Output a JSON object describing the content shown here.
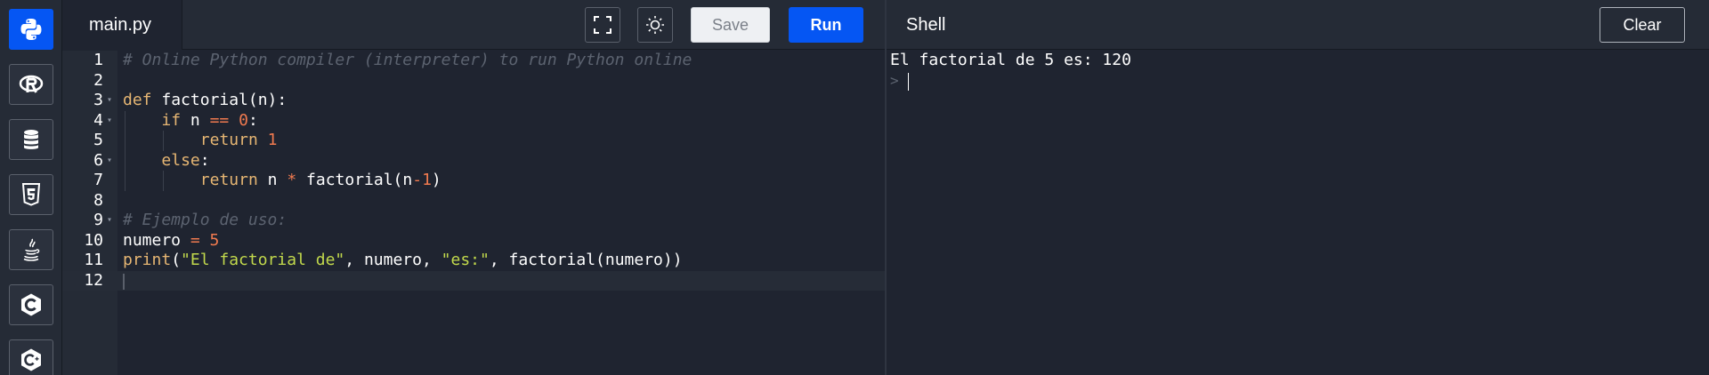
{
  "sidebar": {
    "languages": [
      {
        "name": "Python",
        "icon": "python-icon",
        "active": true
      },
      {
        "name": "R",
        "icon": "r-language-icon",
        "active": false
      },
      {
        "name": "SQL",
        "icon": "database-icon",
        "active": false
      },
      {
        "name": "HTML",
        "icon": "html5-icon",
        "active": false
      },
      {
        "name": "Java",
        "icon": "java-icon",
        "active": false
      },
      {
        "name": "C",
        "icon": "c-language-icon",
        "active": false
      },
      {
        "name": "C++",
        "icon": "cpp-language-icon",
        "active": false
      }
    ]
  },
  "editor": {
    "file_name": "main.py",
    "save_label": "Save",
    "run_label": "Run",
    "fullscreen_icon": "fullscreen-icon",
    "theme_icon": "sun-icon",
    "lines": [
      {
        "number": "1",
        "fold": false,
        "indent": 0,
        "tokens": [
          {
            "t": "# Online Python compiler (interpreter) to run Python online",
            "c": "comment"
          }
        ]
      },
      {
        "number": "2",
        "fold": false,
        "indent": 0,
        "tokens": []
      },
      {
        "number": "3",
        "fold": true,
        "indent": 0,
        "tokens": [
          {
            "t": "def",
            "c": "kw"
          },
          {
            "t": " factorial(n):",
            "c": "id"
          }
        ]
      },
      {
        "number": "4",
        "fold": true,
        "indent": 1,
        "tokens": [
          {
            "t": "if",
            "c": "kw"
          },
          {
            "t": " n ",
            "c": "id"
          },
          {
            "t": "==",
            "c": "op"
          },
          {
            "t": " ",
            "c": "id"
          },
          {
            "t": "0",
            "c": "num"
          },
          {
            "t": ":",
            "c": "id"
          }
        ]
      },
      {
        "number": "5",
        "fold": false,
        "indent": 2,
        "tokens": [
          {
            "t": "return",
            "c": "kw"
          },
          {
            "t": " ",
            "c": "id"
          },
          {
            "t": "1",
            "c": "num"
          }
        ]
      },
      {
        "number": "6",
        "fold": true,
        "indent": 1,
        "tokens": [
          {
            "t": "else",
            "c": "kw"
          },
          {
            "t": ":",
            "c": "id"
          }
        ]
      },
      {
        "number": "7",
        "fold": false,
        "indent": 2,
        "tokens": [
          {
            "t": "return",
            "c": "kw"
          },
          {
            "t": " n ",
            "c": "id"
          },
          {
            "t": "*",
            "c": "op"
          },
          {
            "t": " factorial(n",
            "c": "id"
          },
          {
            "t": "-",
            "c": "op"
          },
          {
            "t": "1",
            "c": "num"
          },
          {
            "t": ")",
            "c": "id"
          }
        ]
      },
      {
        "number": "8",
        "fold": false,
        "indent": 0,
        "tokens": []
      },
      {
        "number": "9",
        "fold": true,
        "indent": 0,
        "tokens": [
          {
            "t": "# Ejemplo de uso:",
            "c": "comment"
          }
        ]
      },
      {
        "number": "10",
        "fold": false,
        "indent": 0,
        "tokens": [
          {
            "t": "numero ",
            "c": "id"
          },
          {
            "t": "=",
            "c": "op"
          },
          {
            "t": " ",
            "c": "id"
          },
          {
            "t": "5",
            "c": "num"
          }
        ]
      },
      {
        "number": "11",
        "fold": false,
        "indent": 0,
        "tokens": [
          {
            "t": "print",
            "c": "kw"
          },
          {
            "t": "(",
            "c": "id"
          },
          {
            "t": "\"El factorial de\"",
            "c": "str"
          },
          {
            "t": ", numero, ",
            "c": "id"
          },
          {
            "t": "\"es:\"",
            "c": "str"
          },
          {
            "t": ", factorial(numero))",
            "c": "id"
          }
        ]
      },
      {
        "number": "12",
        "fold": false,
        "indent": 0,
        "tokens": [],
        "active": true
      }
    ]
  },
  "shell": {
    "title": "Shell",
    "clear_label": "Clear",
    "output": [
      "El factorial de 5 es: 120"
    ],
    "prompt": ">"
  },
  "colors": {
    "accent": "#0556f3",
    "background": "#1f2430",
    "keyword": "#e6b673",
    "number": "#f07a4f",
    "string": "#c2d94c",
    "comment": "#5c6370"
  }
}
